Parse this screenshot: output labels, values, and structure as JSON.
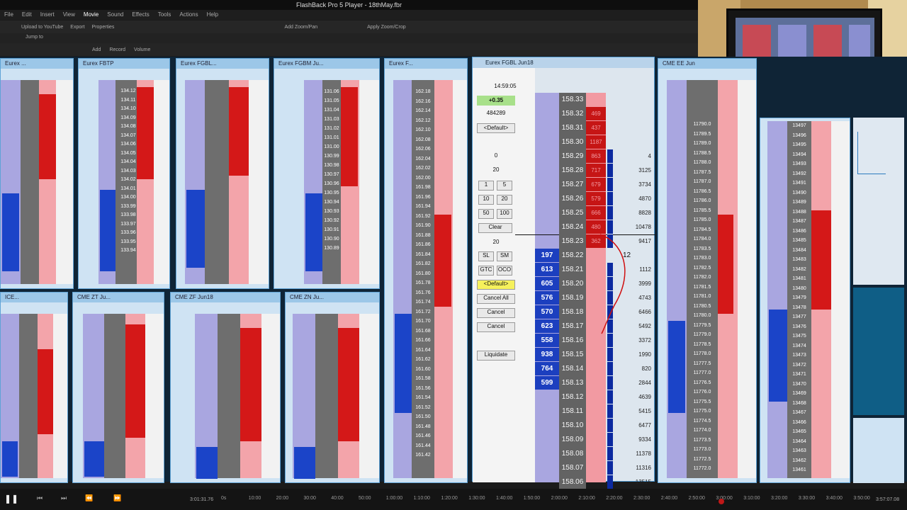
{
  "window": {
    "title": "FlashBack Pro 5 Player - 18thMay.fbr"
  },
  "menu": [
    "File",
    "Edit",
    "Insert",
    "View",
    "Movie",
    "Sound",
    "Effects",
    "Tools",
    "Actions",
    "Help"
  ],
  "toolbar": {
    "upload": "Upload to YouTube",
    "export": "Export",
    "properties": "Properties",
    "add_zoom": "Add Zoom/Pan",
    "apply_zoom": "Apply Zoom/Crop",
    "jump": "Jump to",
    "add": "Add",
    "record": "Record",
    "volume": "Volume"
  },
  "windows": {
    "w1": "Eurex ...",
    "w2": "Eurex FBTP",
    "w3": "Eurex FGBL...",
    "w4": "Eurex FGBM Ju...",
    "w5": "Eurex F...",
    "w6": "CME ZT Ju...",
    "w7": "CME ZF Jun18",
    "w8": "CME ZN Ju...",
    "w9": "CME EE Jun",
    "w10": "ICE..."
  },
  "main": {
    "title": "Eurex FGBL Jun18",
    "time": "14:59:05",
    "change": "+0.35",
    "volume": "484289",
    "default1": "<Default>",
    "qty_top": "0",
    "qty_mid": "20",
    "q1": "1",
    "q5": "5",
    "q10": "10",
    "q20": "20",
    "q50": "50",
    "q100": "100",
    "clear": "Clear",
    "qty_20b": "20",
    "sl": "SL",
    "sm": "SM",
    "gtc": "GTC",
    "oco": "OCO",
    "default2": "<Default>",
    "cancel_all": "Cancel All",
    "cancel": "Cancel",
    "cancel2": "Cancel",
    "liquidate": "Liquidate",
    "working_qty": "12",
    "ladder": [
      {
        "p": "158.33",
        "b": "",
        "a": "",
        "v": ""
      },
      {
        "p": "158.32",
        "b": "",
        "a": "469",
        "v": ""
      },
      {
        "p": "158.31",
        "b": "",
        "a": "437",
        "v": ""
      },
      {
        "p": "158.30",
        "b": "",
        "a": "1187",
        "v": ""
      },
      {
        "p": "158.29",
        "b": "",
        "a": "863",
        "v": "4"
      },
      {
        "p": "158.28",
        "b": "",
        "a": "717",
        "v": "3125"
      },
      {
        "p": "158.27",
        "b": "",
        "a": "679",
        "v": "3734"
      },
      {
        "p": "158.26",
        "b": "",
        "a": "579",
        "v": "4870"
      },
      {
        "p": "158.25",
        "b": "",
        "a": "666",
        "v": "8828"
      },
      {
        "p": "158.24",
        "b": "",
        "a": "480",
        "v": "10478"
      },
      {
        "p": "158.23",
        "b": "",
        "a": "362",
        "v": "9417"
      },
      {
        "p": "158.22",
        "b": "197",
        "a": "",
        "v": ""
      },
      {
        "p": "158.21",
        "b": "613",
        "a": "",
        "v": "1112"
      },
      {
        "p": "158.20",
        "b": "605",
        "a": "",
        "v": "3999"
      },
      {
        "p": "158.19",
        "b": "576",
        "a": "",
        "v": "4743"
      },
      {
        "p": "158.18",
        "b": "570",
        "a": "",
        "v": "6466"
      },
      {
        "p": "158.17",
        "b": "623",
        "a": "",
        "v": "5492"
      },
      {
        "p": "158.16",
        "b": "558",
        "a": "",
        "v": "3372"
      },
      {
        "p": "158.15",
        "b": "938",
        "a": "",
        "v": "1990"
      },
      {
        "p": "158.14",
        "b": "764",
        "a": "",
        "v": "820"
      },
      {
        "p": "158.13",
        "b": "599",
        "a": "",
        "v": "2844"
      },
      {
        "p": "158.12",
        "b": "",
        "a": "",
        "v": "4639"
      },
      {
        "p": "158.11",
        "b": "",
        "a": "",
        "v": "5415"
      },
      {
        "p": "158.10",
        "b": "",
        "a": "",
        "v": "6477"
      },
      {
        "p": "158.09",
        "b": "",
        "a": "",
        "v": "9334"
      },
      {
        "p": "158.08",
        "b": "",
        "a": "",
        "v": "11378"
      },
      {
        "p": "158.07",
        "b": "",
        "a": "",
        "v": "11316"
      },
      {
        "p": "158.06",
        "b": "",
        "a": "",
        "v": "13515"
      }
    ]
  },
  "side_ladders": {
    "fbtp": [
      "134.12",
      "134.11",
      "134.10",
      "134.09",
      "134.08",
      "134.07",
      "134.06",
      "134.05",
      "134.04",
      "134.03",
      "134.02",
      "134.01",
      "134.00",
      "133.99",
      "133.98",
      "133.97",
      "133.96",
      "133.95",
      "133.94"
    ],
    "fgbm": [
      "131.06",
      "131.05",
      "131.04",
      "131.03",
      "131.02",
      "131.01",
      "131.00",
      "130.99",
      "130.98",
      "130.97",
      "130.96",
      "130.95",
      "130.94",
      "130.93",
      "130.92",
      "130.91",
      "130.90",
      "130.89"
    ],
    "ff": [
      "162.18",
      "162.16",
      "162.14",
      "162.12",
      "162.10",
      "162.08",
      "162.06",
      "162.04",
      "162.02",
      "162.00",
      "161.98",
      "161.96",
      "161.94",
      "161.92",
      "161.90",
      "161.88",
      "161.86",
      "161.84",
      "161.82",
      "161.80",
      "161.78",
      "161.76",
      "161.74",
      "161.72",
      "161.70",
      "161.68",
      "161.66",
      "161.64",
      "161.62",
      "161.60",
      "161.58",
      "161.56",
      "161.54",
      "161.52",
      "161.50",
      "161.48",
      "161.46",
      "161.44",
      "161.42"
    ],
    "ee": [
      "11790.0",
      "11789.5",
      "11789.0",
      "11788.5",
      "11788.0",
      "11787.5",
      "11787.0",
      "11786.5",
      "11786.0",
      "11785.5",
      "11785.0",
      "11784.5",
      "11784.0",
      "11783.5",
      "11783.0",
      "11782.5",
      "11782.0",
      "11781.5",
      "11781.0",
      "11780.5",
      "11780.0",
      "11779.5",
      "11779.0",
      "11778.5",
      "11778.0",
      "11777.5",
      "11777.0",
      "11776.5",
      "11776.0",
      "11775.5",
      "11775.0",
      "11774.5",
      "11774.0",
      "11773.5",
      "11773.0",
      "11772.5",
      "11772.0"
    ],
    "r2": [
      "13497",
      "13496",
      "13495",
      "13494",
      "13493",
      "13492",
      "13491",
      "13490",
      "13489",
      "13488",
      "13487",
      "13486",
      "13485",
      "13484",
      "13483",
      "13482",
      "13481",
      "13480",
      "13479",
      "13478",
      "13477",
      "13476",
      "13475",
      "13474",
      "13473",
      "13472",
      "13471",
      "13470",
      "13469",
      "13468",
      "13467",
      "13466",
      "13465",
      "13464",
      "13463",
      "13462",
      "13461"
    ]
  },
  "timeline": {
    "current": "3:01:31.76",
    "end": "3:57:07.08",
    "ticks": [
      "0s",
      "10:00",
      "20:00",
      "30:00",
      "40:00",
      "50:00",
      "1:00:00",
      "1:10:00",
      "1:20:00",
      "1:30:00",
      "1:40:00",
      "1:50:00",
      "2:00:00",
      "2:10:00",
      "2:20:00",
      "2:30:00",
      "2:40:00",
      "2:50:00",
      "3:00:00",
      "3:10:00",
      "3:20:00",
      "3:30:00",
      "3:40:00",
      "3:50:00"
    ]
  }
}
